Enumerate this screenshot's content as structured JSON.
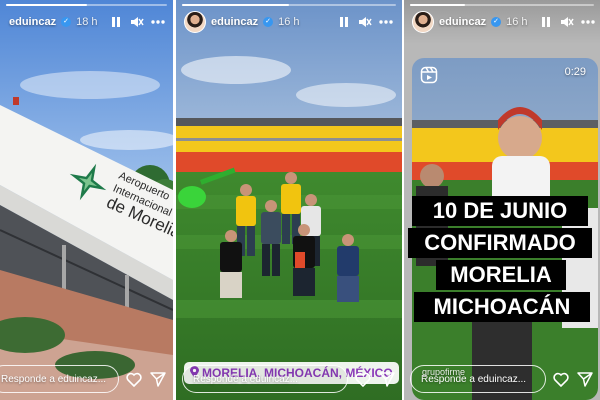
{
  "stories": [
    {
      "username": "eduincaz",
      "time_ago": "18 h",
      "progress": 0.5,
      "reply_placeholder": "Responde a eduincaz...",
      "sign_lines": [
        "Aeropuerto",
        "Internacional",
        "de Morelia"
      ]
    },
    {
      "username": "eduincaz",
      "time_ago": "16 h",
      "progress": 0.5,
      "reply_placeholder": "Responde a eduincaz...",
      "location_sticker": "MORELIA, MICHOACÁN, MÉXICO"
    },
    {
      "username": "eduincaz",
      "time_ago": "16 h",
      "progress": 0.3,
      "reply_placeholder": "Responde a eduincaz...",
      "video_duration": "0:29",
      "reshare_label": "grupofirme",
      "caption_lines": [
        "10 DE JUNIO",
        "CONFIRMADO",
        "MORELIA",
        "MICHOACÁN"
      ]
    }
  ],
  "icons": {
    "pause": "pause-icon",
    "mute": "mute-icon",
    "more": "more-icon",
    "like": "heart-icon",
    "share": "send-icon",
    "reel": "reel-icon",
    "location": "location-pin-icon",
    "verified": "verified-badge-icon"
  },
  "colors": {
    "verified": "#3897f0",
    "sticker_text": "#8a3ab9",
    "stadium_red": "#e04a2a",
    "stadium_yellow": "#f3c71c"
  }
}
